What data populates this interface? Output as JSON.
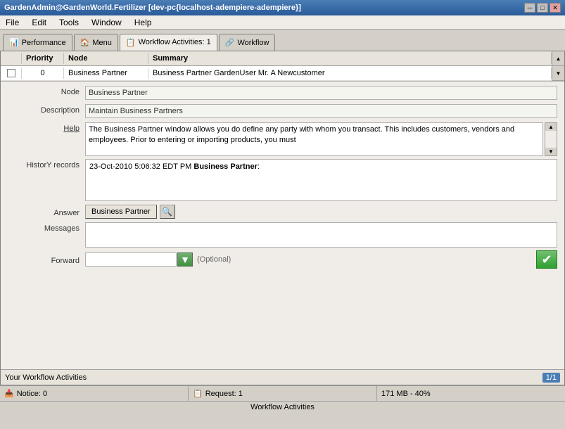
{
  "window": {
    "title": "GardenAdmin@GardenWorld.Fertilizer [dev-pc{localhost-adempiere-adempiere}]"
  },
  "menubar": {
    "items": [
      "File",
      "Edit",
      "Tools",
      "Window",
      "Help"
    ]
  },
  "tabs": [
    {
      "label": "Performance",
      "icon": "📊",
      "active": false
    },
    {
      "label": "Menu",
      "icon": "🏠",
      "active": false
    },
    {
      "label": "Workflow Activities: 1",
      "icon": "📋",
      "active": true
    },
    {
      "label": "Workflow",
      "icon": "🔗",
      "active": false
    }
  ],
  "table": {
    "headers": [
      "Priority",
      "Node",
      "Summary"
    ],
    "rows": [
      {
        "priority": "0",
        "node": "Business Partner",
        "summary": "Business Partner GardenUser Mr. A Newcustomer"
      }
    ]
  },
  "form": {
    "node_label": "Node",
    "node_value": "Business Partner",
    "description_label": "Description",
    "description_value": "Maintain Business Partners",
    "help_label": "Help",
    "help_value": "The Business Partner window allows you do define any party with whom you transact.  This includes customers, vendors and employees.  Prior to entering or importing products, you must",
    "history_label": "HistorY records",
    "history_date": "23-Oct-2010 5:06:32 EDT PM",
    "history_bold": "Business Partner",
    "history_colon": ":",
    "answer_label": "Answer",
    "answer_value": "Business Partner",
    "messages_label": "Messages",
    "messages_value": "",
    "forward_label": "Forward",
    "forward_value": "",
    "forward_placeholder": "",
    "optional_text": "(Optional)"
  },
  "status_bar": {
    "workflow_text": "Your Workflow Activities",
    "page": "1/1"
  },
  "bottom_status": {
    "notice": "Notice: 0",
    "request": "Request: 1",
    "memory": "171 MB - 40%"
  },
  "bottom_label": "Workflow Activities"
}
